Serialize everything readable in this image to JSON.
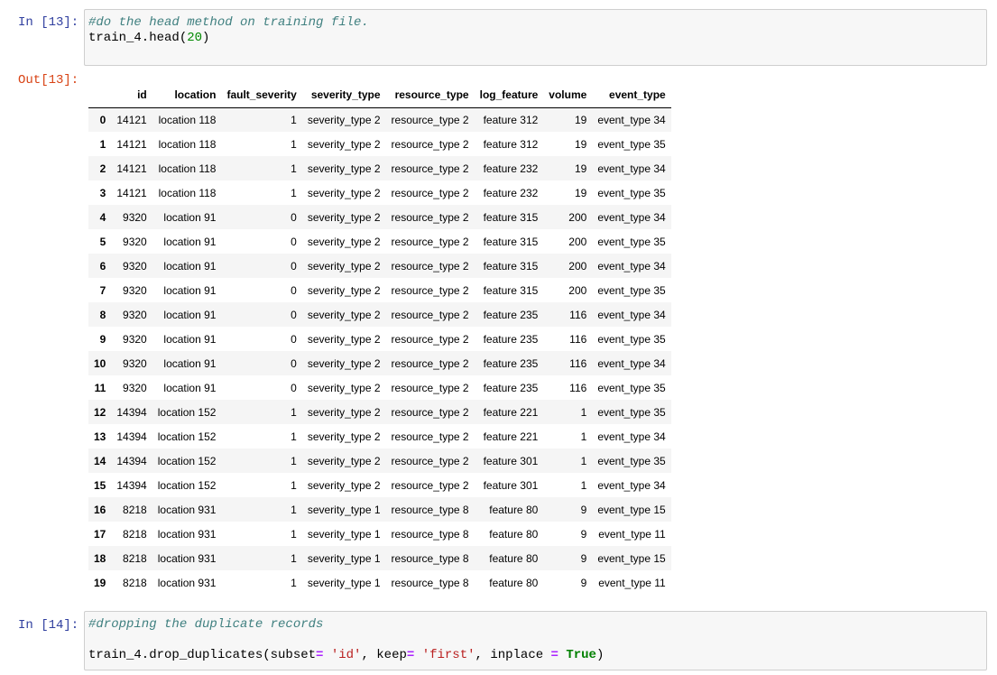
{
  "cells": {
    "in13": {
      "prompt": "In [13]:",
      "comment": "#do the head method on training file.",
      "code_prefix": "train_4.head(",
      "code_number": "20",
      "code_suffix": ")"
    },
    "out13": {
      "prompt": "Out[13]:"
    },
    "in14": {
      "prompt": "In [14]:",
      "comment": "#dropping the duplicate records",
      "code_a": "train_4.drop_duplicates(subset",
      "op_eq1": "=",
      "str_id": " 'id'",
      "code_b": ", keep",
      "op_eq2": "=",
      "str_first": " 'first'",
      "code_c": ", inplace ",
      "op_eq3": "=",
      "kw_true": "True",
      "code_d": ")"
    }
  },
  "table": {
    "columns": [
      "",
      "id",
      "location",
      "fault_severity",
      "severity_type",
      "resource_type",
      "log_feature",
      "volume",
      "event_type"
    ],
    "rows": [
      [
        "0",
        "14121",
        "location 118",
        "1",
        "severity_type 2",
        "resource_type 2",
        "feature 312",
        "19",
        "event_type 34"
      ],
      [
        "1",
        "14121",
        "location 118",
        "1",
        "severity_type 2",
        "resource_type 2",
        "feature 312",
        "19",
        "event_type 35"
      ],
      [
        "2",
        "14121",
        "location 118",
        "1",
        "severity_type 2",
        "resource_type 2",
        "feature 232",
        "19",
        "event_type 34"
      ],
      [
        "3",
        "14121",
        "location 118",
        "1",
        "severity_type 2",
        "resource_type 2",
        "feature 232",
        "19",
        "event_type 35"
      ],
      [
        "4",
        "9320",
        "location 91",
        "0",
        "severity_type 2",
        "resource_type 2",
        "feature 315",
        "200",
        "event_type 34"
      ],
      [
        "5",
        "9320",
        "location 91",
        "0",
        "severity_type 2",
        "resource_type 2",
        "feature 315",
        "200",
        "event_type 35"
      ],
      [
        "6",
        "9320",
        "location 91",
        "0",
        "severity_type 2",
        "resource_type 2",
        "feature 315",
        "200",
        "event_type 34"
      ],
      [
        "7",
        "9320",
        "location 91",
        "0",
        "severity_type 2",
        "resource_type 2",
        "feature 315",
        "200",
        "event_type 35"
      ],
      [
        "8",
        "9320",
        "location 91",
        "0",
        "severity_type 2",
        "resource_type 2",
        "feature 235",
        "116",
        "event_type 34"
      ],
      [
        "9",
        "9320",
        "location 91",
        "0",
        "severity_type 2",
        "resource_type 2",
        "feature 235",
        "116",
        "event_type 35"
      ],
      [
        "10",
        "9320",
        "location 91",
        "0",
        "severity_type 2",
        "resource_type 2",
        "feature 235",
        "116",
        "event_type 34"
      ],
      [
        "11",
        "9320",
        "location 91",
        "0",
        "severity_type 2",
        "resource_type 2",
        "feature 235",
        "116",
        "event_type 35"
      ],
      [
        "12",
        "14394",
        "location 152",
        "1",
        "severity_type 2",
        "resource_type 2",
        "feature 221",
        "1",
        "event_type 35"
      ],
      [
        "13",
        "14394",
        "location 152",
        "1",
        "severity_type 2",
        "resource_type 2",
        "feature 221",
        "1",
        "event_type 34"
      ],
      [
        "14",
        "14394",
        "location 152",
        "1",
        "severity_type 2",
        "resource_type 2",
        "feature 301",
        "1",
        "event_type 35"
      ],
      [
        "15",
        "14394",
        "location 152",
        "1",
        "severity_type 2",
        "resource_type 2",
        "feature 301",
        "1",
        "event_type 34"
      ],
      [
        "16",
        "8218",
        "location 931",
        "1",
        "severity_type 1",
        "resource_type 8",
        "feature 80",
        "9",
        "event_type 15"
      ],
      [
        "17",
        "8218",
        "location 931",
        "1",
        "severity_type 1",
        "resource_type 8",
        "feature 80",
        "9",
        "event_type 11"
      ],
      [
        "18",
        "8218",
        "location 931",
        "1",
        "severity_type 1",
        "resource_type 8",
        "feature 80",
        "9",
        "event_type 15"
      ],
      [
        "19",
        "8218",
        "location 931",
        "1",
        "severity_type 1",
        "resource_type 8",
        "feature 80",
        "9",
        "event_type 11"
      ]
    ]
  },
  "colors": {
    "in_prompt": "#303f9f",
    "out_prompt": "#d84315",
    "comment": "#408080",
    "number": "#080",
    "string": "#ba2121",
    "keyword": "#008000",
    "code_bg": "#f7f7f7",
    "row_stripe": "#f5f5f5"
  }
}
